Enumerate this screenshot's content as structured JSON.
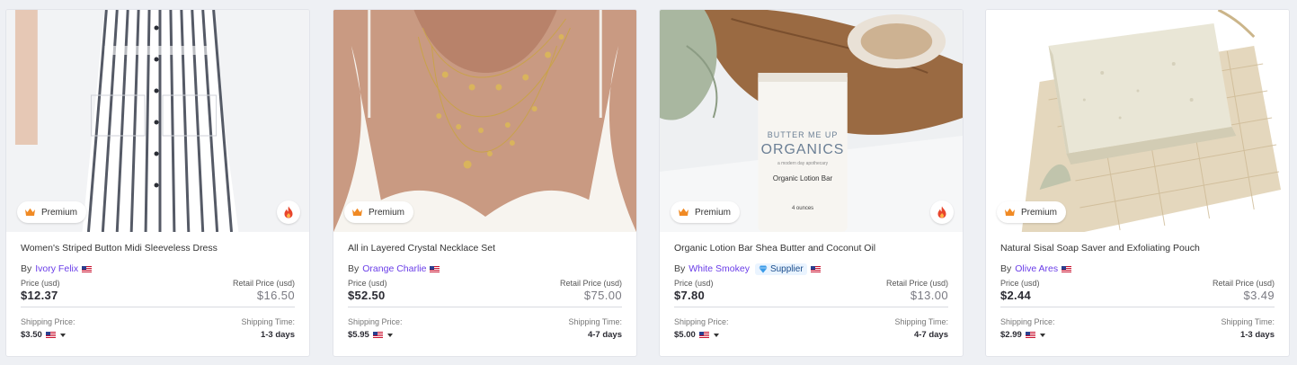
{
  "labels": {
    "premium": "Premium",
    "by": "By",
    "price": "Price (usd)",
    "retail": "Retail Price (usd)",
    "shipping_price": "Shipping Price:",
    "shipping_time": "Shipping Time:",
    "supplier": "Supplier"
  },
  "products": [
    {
      "title": "Women's Striped Button Midi Sleeveless Dress",
      "seller": "Ivory Felix",
      "price": "$12.37",
      "retail": "$16.50",
      "shipping": "$3.50",
      "days": "1-3 days",
      "hot": true,
      "supplier": false
    },
    {
      "title": "All in Layered Crystal Necklace Set",
      "seller": "Orange Charlie",
      "price": "$52.50",
      "retail": "$75.00",
      "shipping": "$5.95",
      "days": "4-7 days",
      "hot": false,
      "supplier": false
    },
    {
      "title": "Organic Lotion Bar Shea Butter and Coconut Oil",
      "seller": "White Smokey",
      "price": "$7.80",
      "retail": "$13.00",
      "shipping": "$5.00",
      "days": "4-7 days",
      "hot": true,
      "supplier": true
    },
    {
      "title": "Natural Sisal Soap Saver and Exfoliating Pouch",
      "seller": "Olive Ares",
      "price": "$2.44",
      "retail": "$3.49",
      "shipping": "$2.99",
      "days": "1-3 days",
      "hot": false,
      "supplier": false
    }
  ],
  "packaging_text": {
    "brand_line1": "BUTTER ME UP",
    "brand_line2": "ORGANICS",
    "tagline": "a modern day apothecary",
    "product": "Organic Lotion Bar",
    "size": "4 ounces"
  },
  "colors": {
    "seller_link": "#6a3de8",
    "crown": "#f08a24",
    "hot": "#e8452c",
    "supplier_bg": "#eaf4ff"
  }
}
